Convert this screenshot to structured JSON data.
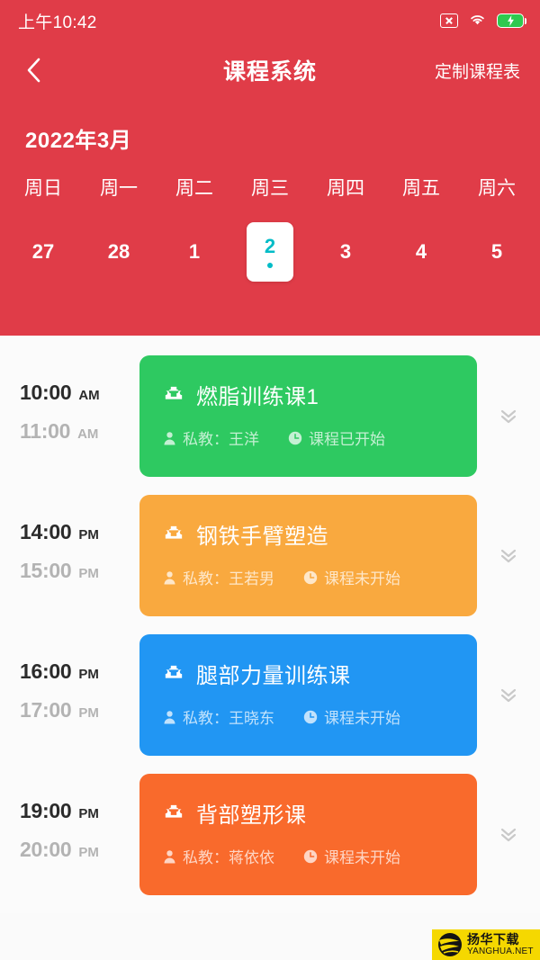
{
  "status_bar": {
    "time": "上午10:42",
    "icons": [
      "no-sim-icon",
      "wifi-icon",
      "battery-charging-icon"
    ]
  },
  "nav": {
    "back_icon": "chevron-left-icon",
    "title": "课程系统",
    "action_label": "定制课程表"
  },
  "calendar": {
    "month_label": "2022年3月",
    "weekdays": [
      "周日",
      "周一",
      "周二",
      "周三",
      "周四",
      "周五",
      "周六"
    ],
    "dates": [
      {
        "day": "27",
        "selected": false,
        "has_dot": false
      },
      {
        "day": "28",
        "selected": false,
        "has_dot": false
      },
      {
        "day": "1",
        "selected": false,
        "has_dot": false
      },
      {
        "day": "2",
        "selected": true,
        "has_dot": true
      },
      {
        "day": "3",
        "selected": false,
        "has_dot": false
      },
      {
        "day": "4",
        "selected": false,
        "has_dot": false
      },
      {
        "day": "5",
        "selected": false,
        "has_dot": false
      }
    ],
    "selected_color": "#00bcc7",
    "header_color": "#e03c48"
  },
  "schedule": [
    {
      "start_time": "10:00",
      "start_meridiem": "AM",
      "end_time": "11:00",
      "end_meridiem": "AM",
      "title": "燃脂训练课1",
      "coach": "私教：王洋",
      "status": "课程已开始",
      "color": "#2ec961",
      "expand_icon": "chevron-double-down-icon"
    },
    {
      "start_time": "14:00",
      "start_meridiem": "PM",
      "end_time": "15:00",
      "end_meridiem": "PM",
      "title": "钢铁手臂塑造",
      "coach": "私教：王若男",
      "status": "课程未开始",
      "color": "#f9a93f",
      "expand_icon": "chevron-double-down-icon"
    },
    {
      "start_time": "16:00",
      "start_meridiem": "PM",
      "end_time": "17:00",
      "end_meridiem": "PM",
      "title": "腿部力量训练课",
      "coach": "私教：王晓东",
      "status": "课程未开始",
      "color": "#2196f3",
      "expand_icon": "chevron-double-down-icon"
    },
    {
      "start_time": "19:00",
      "start_meridiem": "PM",
      "end_time": "20:00",
      "end_meridiem": "PM",
      "title": "背部塑形课",
      "coach": "私教：蒋依依",
      "status": "课程未开始",
      "color": "#f96a2c",
      "expand_icon": "chevron-double-down-icon"
    }
  ],
  "watermark": {
    "cn": "扬华下载",
    "en": "YANGHUA.NET",
    "background": "#f5d800"
  }
}
